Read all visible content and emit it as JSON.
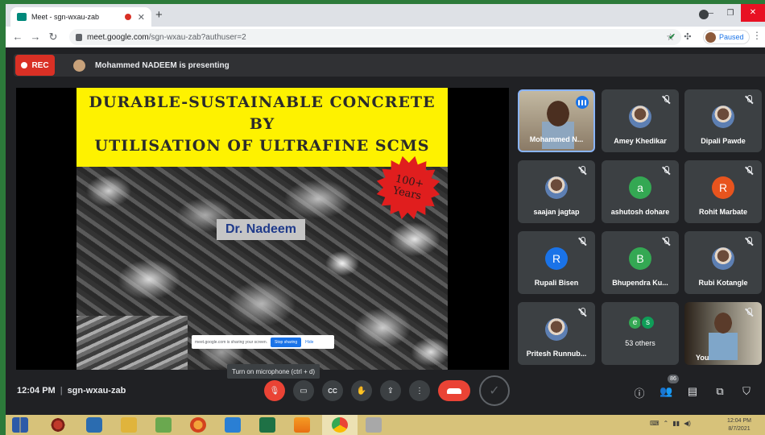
{
  "browser": {
    "tab_title": "Meet - sgn-wxau-zab",
    "url_host": "meet.google.com",
    "url_path": "/sgn-wxau-zab?authuser=2",
    "profile_status": "Paused"
  },
  "meet": {
    "rec_label": "REC",
    "presenting_text": "Mohammed NADEEM is presenting",
    "time": "12:04 PM",
    "meeting_code": "sgn-wxau-zab",
    "tooltip": "Turn on microphone (ctrl + d)",
    "participant_count": "86",
    "others_label": "53 others"
  },
  "slide": {
    "title_line1": "DURABLE-SUSTAINABLE CONCRETE BY",
    "title_line2": "UTILISATION OF ULTRAFINE SCMS",
    "badge_line1": "100+",
    "badge_line2": "Years",
    "author": "Dr. Nadeem",
    "share_notice": "meet.google.com is sharing your screen.",
    "stop_sharing": "Stop sharing",
    "hide": "Hide"
  },
  "participants": [
    {
      "name": "Mohammed N...",
      "avatar": "",
      "color": ""
    },
    {
      "name": "Amey Khedikar",
      "avatar": "",
      "color": "photo"
    },
    {
      "name": "Dipali Pawde",
      "avatar": "",
      "color": "photo"
    },
    {
      "name": "saajan jagtap",
      "avatar": "",
      "color": "photo"
    },
    {
      "name": "ashutosh dohare",
      "avatar": "a",
      "color": "#34a853"
    },
    {
      "name": "Rohit Marbate",
      "avatar": "R",
      "color": "#e8541e"
    },
    {
      "name": "Rupali Bisen",
      "avatar": "R",
      "color": "#1a73e8"
    },
    {
      "name": "Bhupendra Ku...",
      "avatar": "B",
      "color": "#34a853"
    },
    {
      "name": "Rubi Kotangle",
      "avatar": "",
      "color": "photo"
    },
    {
      "name": "Pritesh Runnub...",
      "avatar": "",
      "color": "photo"
    },
    {
      "name": "53 others",
      "avatar": "",
      "color": ""
    },
    {
      "name": "You",
      "avatar": "",
      "color": ""
    }
  ],
  "others_avatars": [
    "e",
    "s"
  ],
  "taskbar": {
    "time": "12:04 PM",
    "date": "8/7/2021"
  },
  "colors": {
    "rec_red": "#d93025",
    "slide_yellow": "#fef200",
    "end_call": "#ea4335",
    "meet_bg": "#202124"
  }
}
